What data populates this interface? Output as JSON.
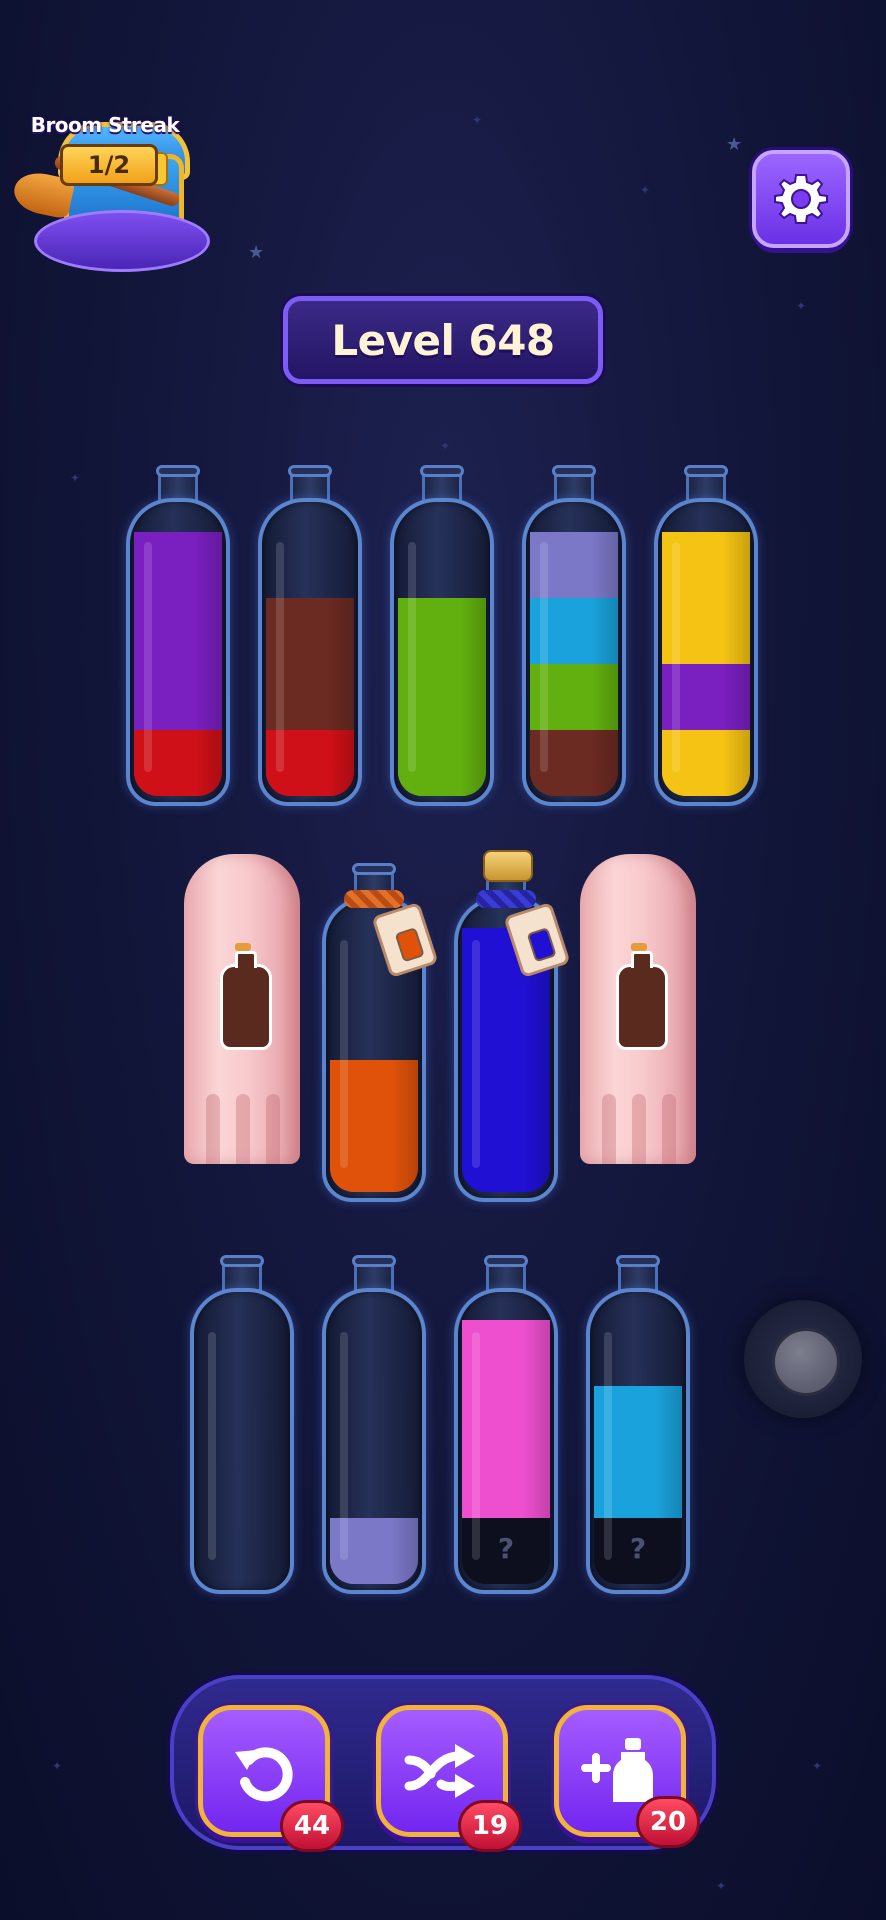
{
  "header": {
    "streak": {
      "title": "Broom Streak",
      "count": "1/2"
    },
    "level": "Level 648"
  },
  "icons": {
    "settings": "gear-icon",
    "undo": "undo-icon",
    "shuffle": "shuffle-icon",
    "add_bottle": "add-bottle-icon",
    "joystick": "joystick-icon"
  },
  "colors": {
    "purple": "#7a1fc0",
    "red": "#cf1018",
    "brown": "#6b2a22",
    "green": "#62b00f",
    "lavender": "#7b78c8",
    "cyan": "#1aa2dc",
    "yellow": "#f5c313",
    "orange": "#e0520a",
    "blue": "#2010d4",
    "pink": "#ee4fcf"
  },
  "board": {
    "row1": [
      {
        "layers": [
          "red",
          "purple",
          "purple",
          "purple"
        ]
      },
      {
        "layers": [
          "red",
          "brown",
          "brown"
        ]
      },
      {
        "layers": [
          "green",
          "green",
          "green"
        ]
      },
      {
        "layers": [
          "brown",
          "green",
          "cyan",
          "lavender"
        ]
      },
      {
        "layers": [
          "yellow",
          "purple",
          "yellow",
          "yellow"
        ]
      }
    ],
    "row2": [
      {
        "covered": true
      },
      {
        "layers": [
          "orange",
          "orange"
        ],
        "locked_with": "orange"
      },
      {
        "layers": [
          "blue",
          "blue",
          "blue",
          "blue"
        ],
        "locked_with": "blue"
      },
      {
        "covered": true
      }
    ],
    "row3": [
      {
        "layers": []
      },
      {
        "layers": [
          "lavender"
        ]
      },
      {
        "layers": [
          "unknown",
          "pink",
          "pink",
          "pink"
        ],
        "unknown_mark": "?"
      },
      {
        "layers": [
          "unknown",
          "cyan",
          "cyan"
        ],
        "unknown_mark": "?"
      }
    ]
  },
  "powerups": {
    "undo": {
      "count": "44"
    },
    "shuffle": {
      "count": "19"
    },
    "add_bottle": {
      "count": "20"
    }
  }
}
